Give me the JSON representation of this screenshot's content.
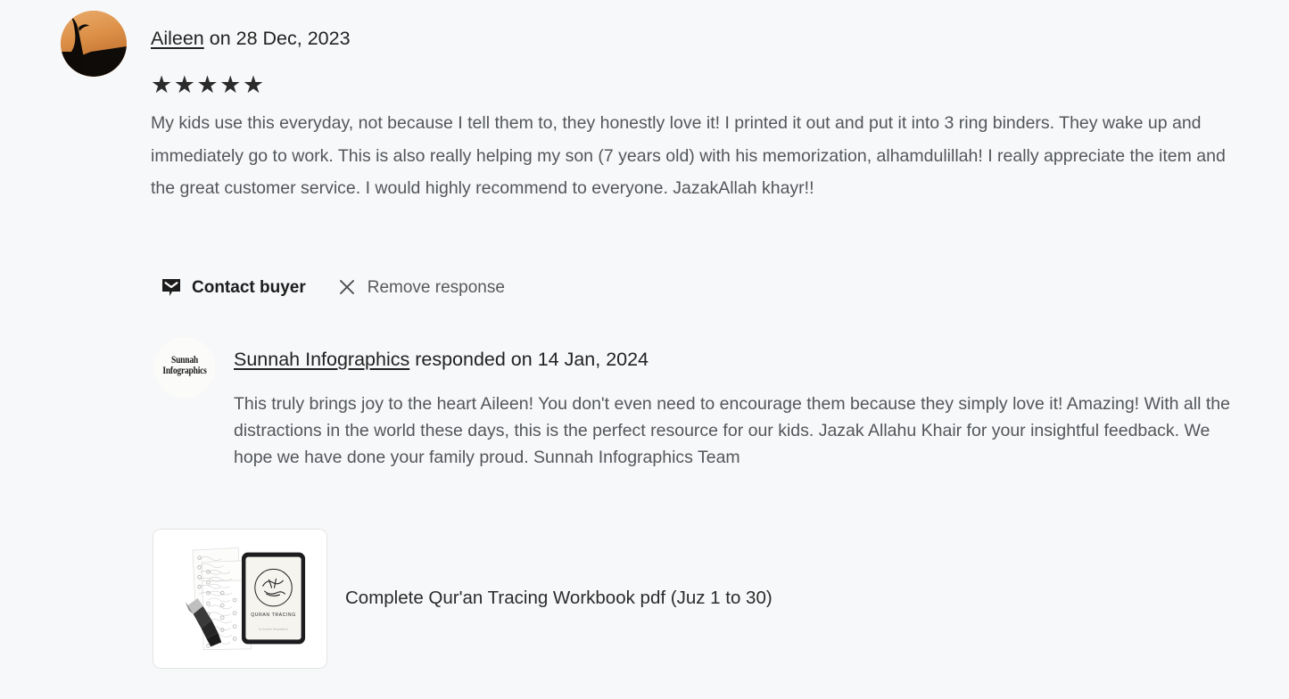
{
  "review": {
    "buyer_name": "Aileen",
    "date_prefix": "on",
    "date": "28 Dec, 2023",
    "header_line": "Aileen on 28 Dec, 2023",
    "rating": 5,
    "rating_stars": "★★★★★",
    "body": "My kids use this everyday, not because I tell them to, they honestly love it! I printed it out and put it into 3 ring binders. They wake up and immediately go to work. This is also really helping my son (7 years old) with his memorization, alhamdulillah! I really appreciate the item and the great customer service. I would highly recommend to everyone. JazakAllah khayr!!",
    "avatar_alt": "buyer-avatar-sunset-silhouette"
  },
  "actions": {
    "contact_buyer_label": "Contact buyer",
    "contact_buyer_icon": "message-envelope-icon",
    "remove_response_label": "Remove response",
    "remove_response_icon": "close-x-icon"
  },
  "response": {
    "shop_name": "Sunnah Infographics",
    "responded_verb": "responded on",
    "date": "14 Jan, 2024",
    "header_line": "Sunnah Infographics responded on 14 Jan, 2024",
    "body": "This truly brings joy to the heart Aileen! You don't even need to encourage them because they simply love it! Amazing! With all the distractions in the world these days, this is the perfect resource for our kids. Jazak Allahu Khair for your insightful feedback. We hope we have done your family proud. Sunnah Infographics Team",
    "avatar_line1": "Sunnah",
    "avatar_line2": "Infographics"
  },
  "listing": {
    "title": "Complete Qur'an Tracing Workbook pdf (Juz 1 to 30)",
    "thumb_caption": "QURAN TRACING",
    "thumb_subcaption": "by Sunnah Infographics",
    "thumb_alt": "listing-thumbnail-quran-tracing-workbook"
  },
  "colors": {
    "page_background": "#f7f8f9",
    "body_text": "#53565a",
    "heading_text": "#222222",
    "star": "#2b2b2b",
    "card_border": "#e2e4e1",
    "avatar_sky_top": "#e8a765",
    "avatar_sky_bottom": "#c9762f",
    "silhouette": "#120e0b"
  }
}
